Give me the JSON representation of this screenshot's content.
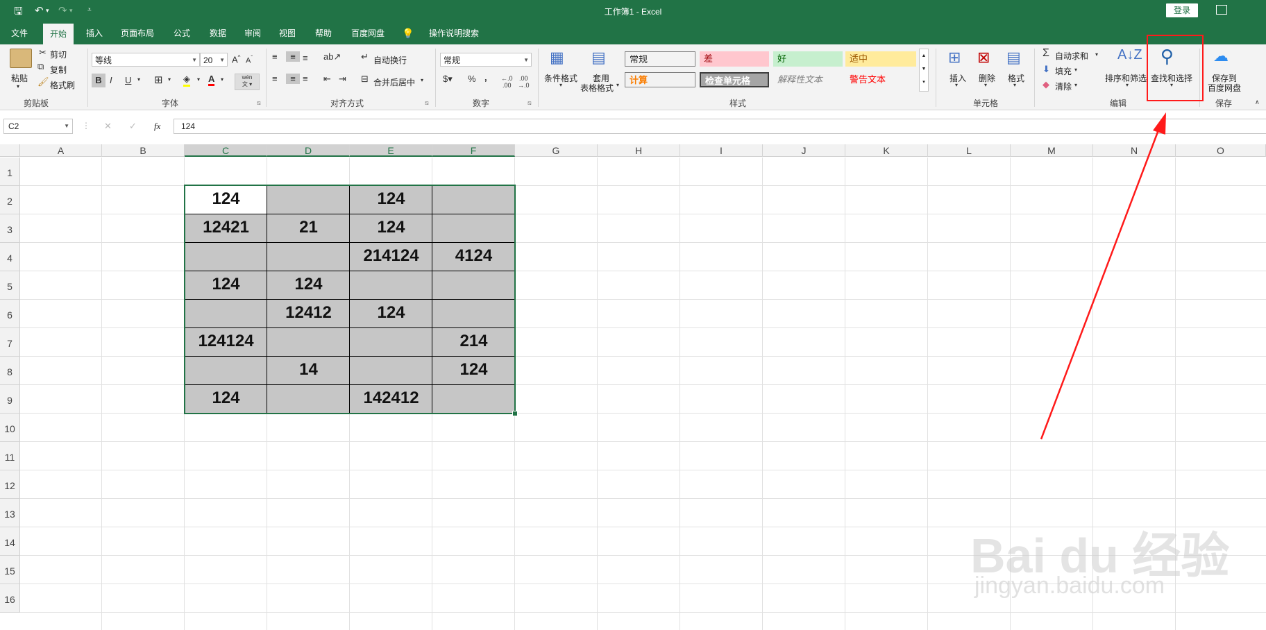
{
  "titlebar": {
    "title": "工作簿1  -  Excel",
    "login": "登录"
  },
  "tabs": [
    "文件",
    "开始",
    "插入",
    "页面布局",
    "公式",
    "数据",
    "审阅",
    "视图",
    "帮助",
    "百度网盘",
    "操作说明搜索"
  ],
  "clipboard": {
    "paste": "粘贴",
    "cut": "剪切",
    "copy": "复制",
    "format_painter": "格式刷",
    "group": "剪贴板"
  },
  "font": {
    "name": "等线",
    "size": "20",
    "bold": "B",
    "italic": "I",
    "underline": "U",
    "group": "字体",
    "pinyin": "wén"
  },
  "alignment": {
    "wrap": "自动换行",
    "merge": "合并后居中",
    "group": "对齐方式"
  },
  "number": {
    "format": "常规",
    "group": "数字",
    "percent": "%",
    "comma": ","
  },
  "styles": {
    "conditional": "条件格式",
    "table_format_1": "套用",
    "table_format_2": "表格格式",
    "group": "样式",
    "cells": [
      {
        "label": "常规",
        "bg": "#ffffff",
        "color": "#000000"
      },
      {
        "label": "差",
        "bg": "#ffc7ce",
        "color": "#9c0006"
      },
      {
        "label": "好",
        "bg": "#c6efce",
        "color": "#006100"
      },
      {
        "label": "适中",
        "bg": "#ffeb9c",
        "color": "#9c5700"
      },
      {
        "label": "计算",
        "bg": "#f2f2f2",
        "color": "#fa7d00"
      },
      {
        "label": "检查单元格",
        "bg": "#a5a5a5",
        "color": "#ffffff"
      },
      {
        "label": "解释性文本",
        "bg": "#f3f3f3",
        "color": "#7f7f7f"
      },
      {
        "label": "警告文本",
        "bg": "#f3f3f3",
        "color": "#ff0000"
      }
    ]
  },
  "cells_group": {
    "insert": "插入",
    "delete": "删除",
    "format": "格式",
    "group": "单元格"
  },
  "editing": {
    "autosum": "自动求和",
    "fill": "填充",
    "clear": "清除",
    "sort": "排序和筛选",
    "find": "查找和选择",
    "group": "编辑"
  },
  "save": {
    "label1": "保存到",
    "label2": "百度网盘",
    "group": "保存"
  },
  "formula_bar": {
    "name_box": "C2",
    "fx": "fx",
    "value": "124"
  },
  "columns": [
    "A",
    "B",
    "C",
    "D",
    "E",
    "F",
    "G",
    "H",
    "I",
    "J",
    "K",
    "L",
    "M",
    "N",
    "O"
  ],
  "rows": [
    "1",
    "2",
    "3",
    "4",
    "5",
    "6",
    "7",
    "8",
    "9",
    "10",
    "11",
    "12",
    "13",
    "14",
    "15",
    "16"
  ],
  "table": [
    [
      "124",
      "",
      "124",
      ""
    ],
    [
      "12421",
      "21",
      "124",
      ""
    ],
    [
      "",
      "",
      "214124",
      "4124"
    ],
    [
      "124",
      "124",
      "",
      ""
    ],
    [
      "",
      "12412",
      "124",
      ""
    ],
    [
      "124124",
      "",
      "",
      "214"
    ],
    [
      "",
      "14",
      "",
      "124"
    ],
    [
      "124",
      "",
      "142412",
      ""
    ]
  ],
  "colors": {
    "excel_green": "#217346",
    "selection_fill": "#c6c6c6",
    "annotation_red": "#ff1a1a"
  },
  "watermark": {
    "brand": "Bai du 经验",
    "url": "jingyan.baidu.com"
  }
}
